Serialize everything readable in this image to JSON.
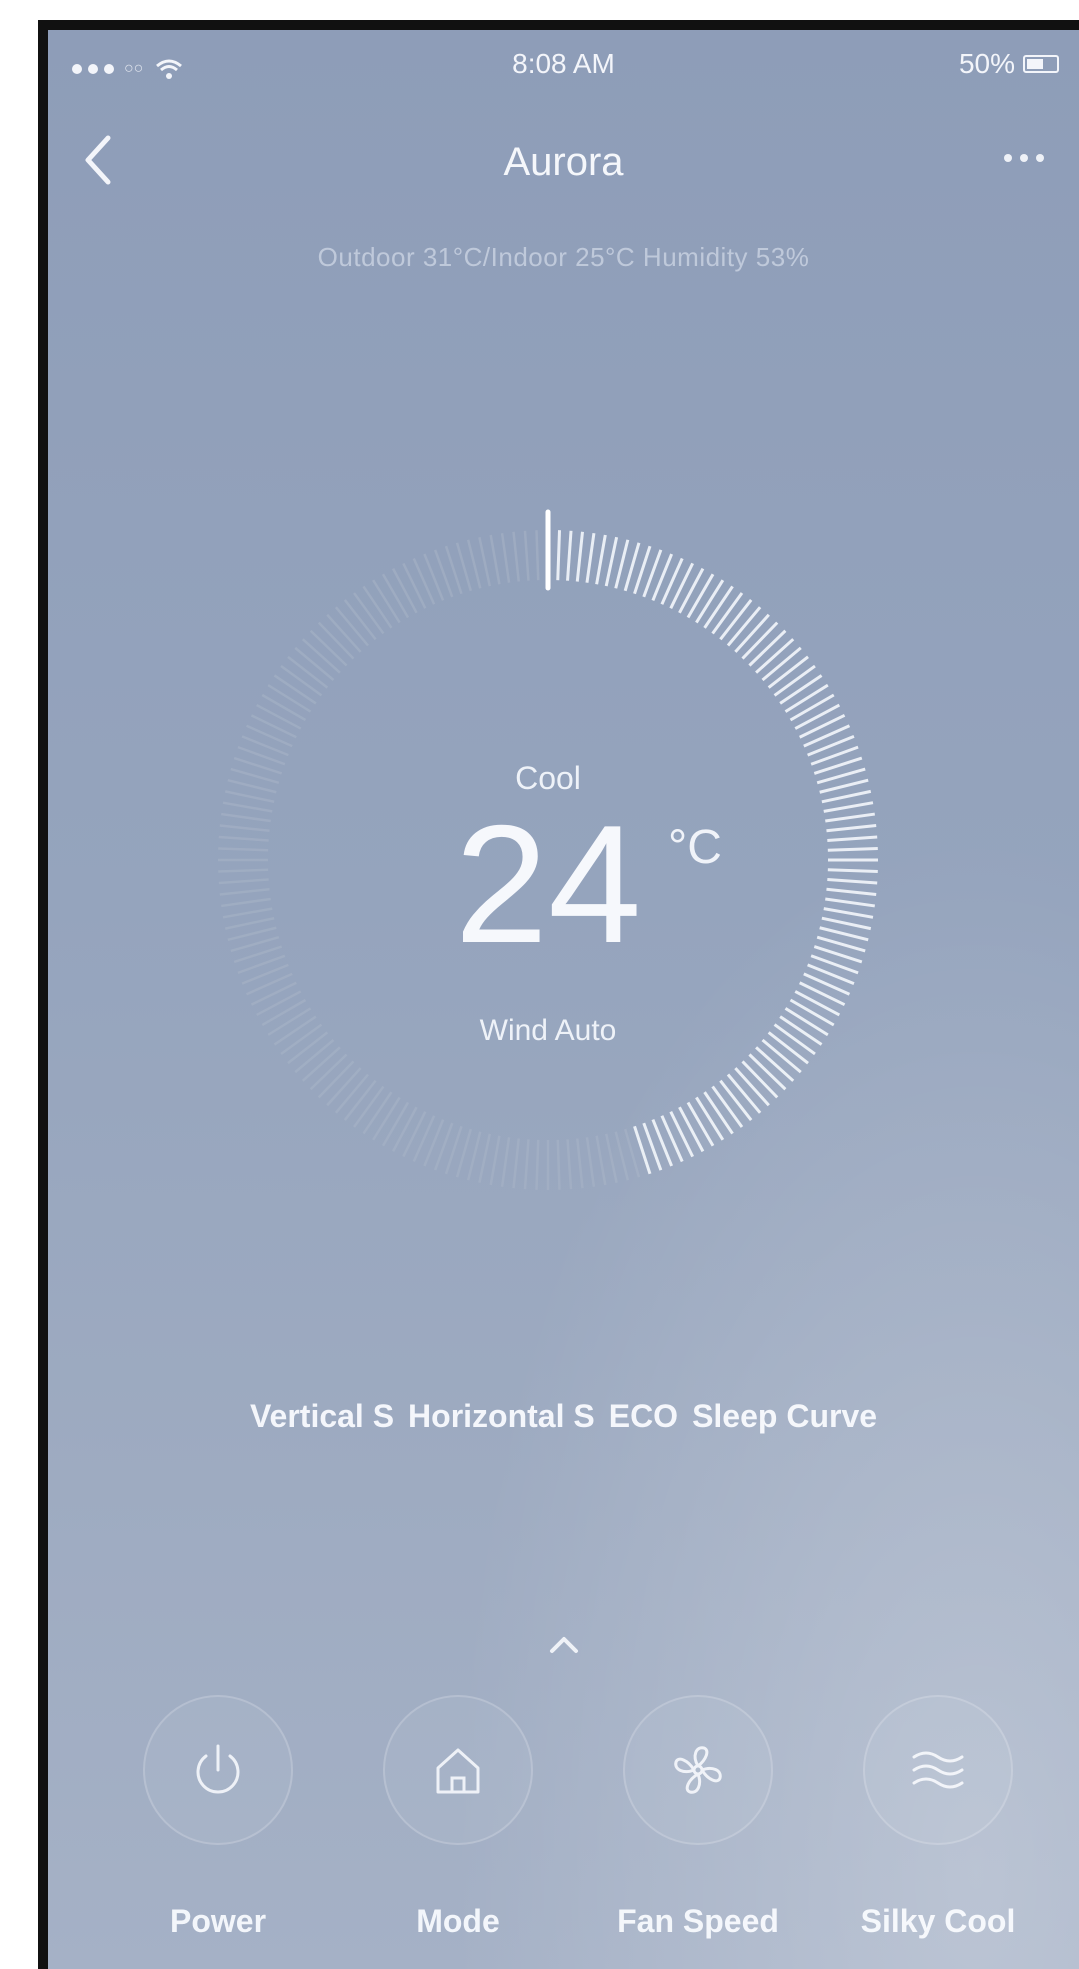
{
  "status_bar": {
    "carrier": "○○",
    "time": "8:08 AM",
    "battery": "50%"
  },
  "nav": {
    "title": "Aurora"
  },
  "conditions": "Outdoor 31°C/Indoor 25°C Humidity 53%",
  "thermostat": {
    "mode": "Cool",
    "temperature": "24",
    "unit": "°C",
    "wind": "Wind Auto",
    "dial_level": 0.45
  },
  "functions": [
    "Vertical S",
    "Horizontal S",
    "ECO",
    "Sleep Curve"
  ],
  "controls": {
    "power": "Power",
    "mode": "Mode",
    "fan_speed": "Fan Speed",
    "silky_cool": "Silky Cool"
  },
  "colors": {
    "background": "#95a4bd",
    "text": "#f4f6fb",
    "active_ticks": "#eef2f8",
    "inactive_ticks": "#aab5c8"
  },
  "icons": {
    "back": "back-chevron-icon",
    "more": "more-dots-icon",
    "expand": "chevron-up-icon",
    "power": "power-icon",
    "mode": "home-icon",
    "fan": "fan-icon",
    "silky": "wave-icon"
  }
}
